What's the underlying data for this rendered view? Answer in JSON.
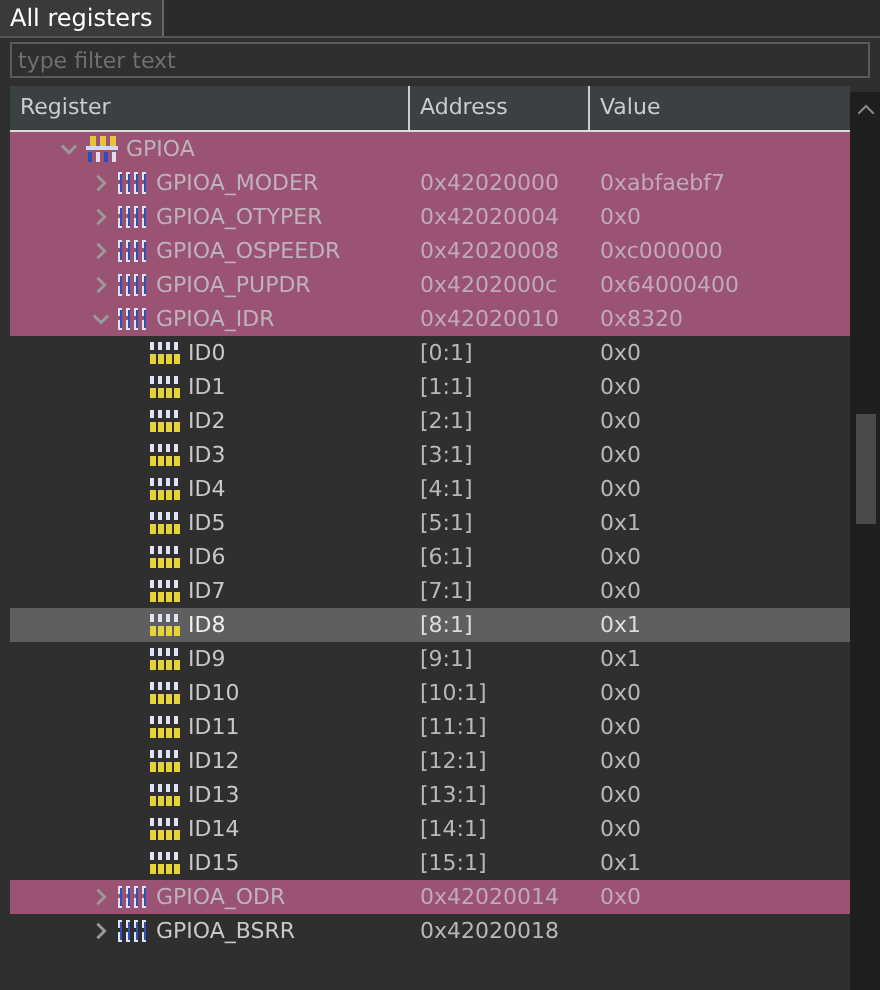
{
  "tab": {
    "label": "All registers",
    "selected": true
  },
  "filter": {
    "placeholder": "type filter text"
  },
  "columns": [
    "Register",
    "Address",
    "Value"
  ],
  "tree": [
    {
      "kind": "peripheral",
      "name": "GPIOA",
      "expanded": true,
      "highlighted": true,
      "selected": false,
      "children": [
        {
          "kind": "register",
          "name": "GPIOA_MODER",
          "address": "0x42020000",
          "value": "0xabfaebf7",
          "expanded": false,
          "highlighted": true,
          "selected": false
        },
        {
          "kind": "register",
          "name": "GPIOA_OTYPER",
          "address": "0x42020004",
          "value": "0x0",
          "expanded": false,
          "highlighted": true,
          "selected": false
        },
        {
          "kind": "register",
          "name": "GPIOA_OSPEEDR",
          "address": "0x42020008",
          "value": "0xc000000",
          "expanded": false,
          "highlighted": true,
          "selected": false
        },
        {
          "kind": "register",
          "name": "GPIOA_PUPDR",
          "address": "0x4202000c",
          "value": "0x64000400",
          "expanded": false,
          "highlighted": true,
          "selected": false
        },
        {
          "kind": "register",
          "name": "GPIOA_IDR",
          "address": "0x42020010",
          "value": "0x8320",
          "expanded": true,
          "highlighted": true,
          "selected": false,
          "children": [
            {
              "kind": "field",
              "name": "ID0",
              "address": "[0:1]",
              "value": "0x0",
              "highlighted": false,
              "selected": false
            },
            {
              "kind": "field",
              "name": "ID1",
              "address": "[1:1]",
              "value": "0x0",
              "highlighted": false,
              "selected": false
            },
            {
              "kind": "field",
              "name": "ID2",
              "address": "[2:1]",
              "value": "0x0",
              "highlighted": false,
              "selected": false
            },
            {
              "kind": "field",
              "name": "ID3",
              "address": "[3:1]",
              "value": "0x0",
              "highlighted": false,
              "selected": false
            },
            {
              "kind": "field",
              "name": "ID4",
              "address": "[4:1]",
              "value": "0x0",
              "highlighted": false,
              "selected": false
            },
            {
              "kind": "field",
              "name": "ID5",
              "address": "[5:1]",
              "value": "0x1",
              "highlighted": false,
              "selected": false
            },
            {
              "kind": "field",
              "name": "ID6",
              "address": "[6:1]",
              "value": "0x0",
              "highlighted": false,
              "selected": false
            },
            {
              "kind": "field",
              "name": "ID7",
              "address": "[7:1]",
              "value": "0x0",
              "highlighted": false,
              "selected": false
            },
            {
              "kind": "field",
              "name": "ID8",
              "address": "[8:1]",
              "value": "0x1",
              "highlighted": false,
              "selected": true
            },
            {
              "kind": "field",
              "name": "ID9",
              "address": "[9:1]",
              "value": "0x1",
              "highlighted": false,
              "selected": false
            },
            {
              "kind": "field",
              "name": "ID10",
              "address": "[10:1]",
              "value": "0x0",
              "highlighted": false,
              "selected": false
            },
            {
              "kind": "field",
              "name": "ID11",
              "address": "[11:1]",
              "value": "0x0",
              "highlighted": false,
              "selected": false
            },
            {
              "kind": "field",
              "name": "ID12",
              "address": "[12:1]",
              "value": "0x0",
              "highlighted": false,
              "selected": false
            },
            {
              "kind": "field",
              "name": "ID13",
              "address": "[13:1]",
              "value": "0x0",
              "highlighted": false,
              "selected": false
            },
            {
              "kind": "field",
              "name": "ID14",
              "address": "[14:1]",
              "value": "0x0",
              "highlighted": false,
              "selected": false
            },
            {
              "kind": "field",
              "name": "ID15",
              "address": "[15:1]",
              "value": "0x1",
              "highlighted": false,
              "selected": false
            }
          ]
        },
        {
          "kind": "register",
          "name": "GPIOA_ODR",
          "address": "0x42020014",
          "value": "0x0",
          "expanded": false,
          "highlighted": true,
          "selected": false
        },
        {
          "kind": "register",
          "name": "GPIOA_BSRR",
          "address": "0x42020018",
          "expanded": false,
          "highlighted": false,
          "selected": false
        }
      ]
    }
  ]
}
